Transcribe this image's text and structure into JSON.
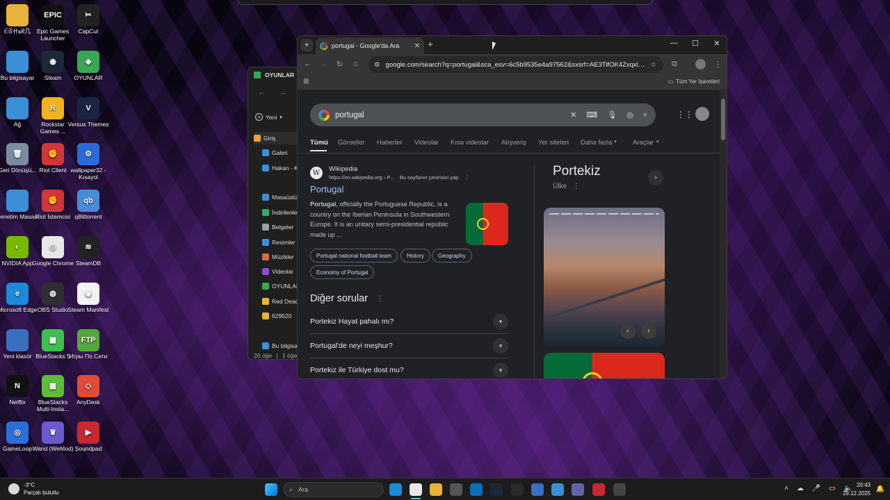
{
  "desktop": {
    "icons": [
      {
        "label": "ᗴᘔ卄ꮶᖇ几",
        "icon": "folder-icon",
        "color": "#e8b339"
      },
      {
        "label": "Epic Games Launcher",
        "icon": "epic-icon",
        "color": "#111111",
        "text": "EPIC"
      },
      {
        "label": "CapCut",
        "icon": "capcut-icon",
        "color": "#222222",
        "text": "✂"
      },
      {
        "label": "Bu bilgisayar",
        "icon": "computer-icon",
        "color": "#3a8fd6"
      },
      {
        "label": "Steam",
        "icon": "steam-icon",
        "color": "#1b2838",
        "text": "◉"
      },
      {
        "label": "OYUNLAR",
        "icon": "games-folder-icon",
        "color": "#3aa655",
        "text": "◆"
      },
      {
        "label": "Ağ",
        "icon": "network-icon",
        "color": "#3a8fd6"
      },
      {
        "label": "Rockstar Games ...",
        "icon": "rockstar-icon",
        "color": "#f2b21c",
        "text": "R"
      },
      {
        "label": "Versus Themes",
        "icon": "versus-icon",
        "color": "#1a2440",
        "text": "V"
      },
      {
        "label": "Geri Dönüşü...",
        "icon": "recycle-bin-icon",
        "color": "#7a8da0",
        "text": "🗑"
      },
      {
        "label": "Riot Client",
        "icon": "riot-icon",
        "color": "#d13639",
        "text": "✊"
      },
      {
        "label": "wallpaper32 - Kısayol",
        "icon": "wallpaper-engine-icon",
        "color": "#2a6bd8",
        "text": "⚙"
      },
      {
        "label": "Denetim Masası",
        "icon": "control-panel-icon",
        "color": "#3a8fd6"
      },
      {
        "label": "Riot İstemcisi",
        "icon": "riot-client-icon",
        "color": "#d13639",
        "text": "✊"
      },
      {
        "label": "qBittorrent",
        "icon": "qbittorrent-icon",
        "color": "#4a8ad6",
        "text": "qb"
      },
      {
        "label": "NVIDIA App",
        "icon": "nvidia-icon",
        "color": "#76b900",
        "text": "◐"
      },
      {
        "label": "Google Chrome",
        "icon": "chrome-icon",
        "color": "#e8e8e8",
        "text": "◎"
      },
      {
        "label": "SteamDB",
        "icon": "steamdb-icon",
        "color": "#222222",
        "text": "≋"
      },
      {
        "label": "Microsoft Edge",
        "icon": "edge-icon",
        "color": "#1b8ad8",
        "text": "e"
      },
      {
        "label": "OBS Studio",
        "icon": "obs-icon",
        "color": "#302e31",
        "text": "◍"
      },
      {
        "label": "Steam Manifest",
        "icon": "steam-manifest-icon",
        "color": "#f2f2f2",
        "text": "◉"
      },
      {
        "label": "Yeni klasör",
        "icon": "new-folder-icon",
        "color": "#3a6fbf"
      },
      {
        "label": "BlueStacks 5",
        "icon": "bluestacks-icon",
        "color": "#3fbf4f",
        "text": "▦"
      },
      {
        "label": "Игры По Сети",
        "icon": "ftp-icon",
        "color": "#54a83b",
        "text": "FTP"
      },
      {
        "label": "Netflix",
        "icon": "netflix-icon",
        "color": "#111111",
        "text": "N"
      },
      {
        "label": "BlueStacks Multi-Insta...",
        "icon": "bluestacks-multi-icon",
        "color": "#5bbf3a",
        "text": "▦"
      },
      {
        "label": "AnyDesk",
        "icon": "anydesk-icon",
        "color": "#e04a3a",
        "text": "◇"
      },
      {
        "label": "GameLoop",
        "icon": "gameloop-icon",
        "color": "#2b6fd8",
        "text": "◎"
      },
      {
        "label": "Wand (WeMod)",
        "icon": "wand-icon",
        "color": "#6a5acd",
        "text": "♛"
      },
      {
        "label": "Soundpad",
        "icon": "soundpad-icon",
        "color": "#c8282f",
        "text": "▶"
      }
    ]
  },
  "explorer": {
    "title": "OYUNLAR",
    "new_label": "Yeni",
    "items": [
      {
        "label": "Giriş",
        "color": "#e8a33b"
      },
      {
        "label": "Galeri",
        "color": "#3a8fd6"
      },
      {
        "label": "Hakan - K",
        "color": "#3a8fd6"
      },
      {
        "label": "Masaüstü",
        "color": "#3a8fd6"
      },
      {
        "label": "İndirilenle",
        "color": "#2fae6a"
      },
      {
        "label": "Belgeler",
        "color": "#9aa0a6"
      },
      {
        "label": "Resimler",
        "color": "#3a8fd6"
      },
      {
        "label": "Müzikler",
        "color": "#e0664a"
      },
      {
        "label": "Videolar",
        "color": "#8a4fd6"
      },
      {
        "label": "OYUNLAR",
        "color": "#3aa655"
      },
      {
        "label": "Red Dead",
        "color": "#e8b339"
      },
      {
        "label": "629520",
        "color": "#e8b339"
      },
      {
        "label": "Bu bilgisa",
        "color": "#3a8fd6"
      }
    ],
    "status_count": "26 öğe",
    "status_selected": "1 öğe s"
  },
  "browser": {
    "tab_title": "portugal - Google'da Ara",
    "url": "google.com/search?q=portugal&sca_esv=6c5b9535e4a97562&sxsrf=AE3TifOK4Zxqxl7L...",
    "bookmarks_label": "Tüm Yer İşaretleri",
    "search_query": "portugal",
    "filters": [
      "Tümü",
      "Görseller",
      "Haberler",
      "Videolar",
      "Kısa videolar",
      "Alışveriş",
      "Yer siteleri",
      "Daha fazla",
      "Araçlar"
    ],
    "result": {
      "site": "Wikipedia",
      "url": "https://en.wikipedia.org › P...",
      "translate": "Bu sayfanın çevirisini yap",
      "title": "Portugal",
      "snippet_bold": "Portugal",
      "snippet": ", officially the Portuguese Republic, is a country on the Iberian Peninsula in Southwestern Europe. It is an unitary semi-presidential republic made up ...",
      "chips": [
        "Portugal national football team",
        "History",
        "Geography",
        "Economy of Portugal"
      ]
    },
    "paa_title": "Diğer sorular",
    "questions": [
      "Portekiz Hayat pahalı mı?",
      "Portugal'de neyi meşhur?",
      "Portekiz ile Türkiye dost mu?"
    ],
    "knowledge_panel": {
      "title": "Portekiz",
      "subtitle": "Ülke"
    }
  },
  "taskbar": {
    "search_placeholder": "Ara",
    "weather_temp": "-3°C",
    "weather_desc": "Parçalı bulutlu",
    "time": "20:43",
    "date": "29.12.2025"
  }
}
